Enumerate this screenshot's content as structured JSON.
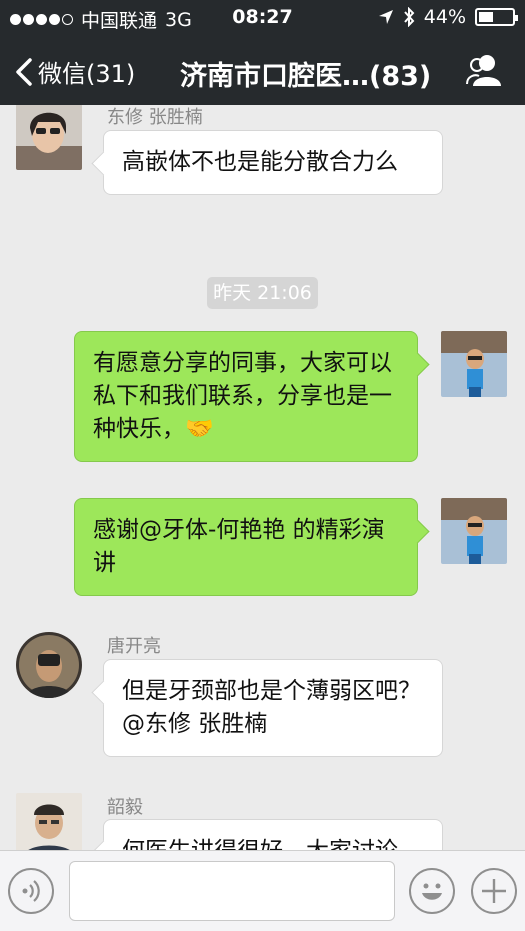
{
  "status_bar": {
    "carrier": "中国联通",
    "network": "3G",
    "time": "08:27",
    "battery": "44%",
    "signal_bars": 4
  },
  "nav": {
    "back_label": "微信(31)",
    "title": "济南市口腔医…(83)",
    "profile_icon": "group-profile-icon"
  },
  "messages": [
    {
      "side": "left",
      "sender": "东修 张胜楠",
      "text": "高嵌体不也是能分散合力么"
    },
    {
      "side": "right",
      "text": "有愿意分享的同事，大家可以私下和我们联系，分享也是一种快乐，🤝"
    },
    {
      "side": "right",
      "text": "感谢@牙体-何艳艳 的精彩演讲"
    },
    {
      "side": "left",
      "sender": "唐开亮",
      "text": "但是牙颈部也是个薄弱区吧？@东修 张胜楠"
    },
    {
      "side": "left",
      "sender": "韶毅",
      "text": "何医生讲得很好，大家讨论"
    }
  ],
  "timestamp": "昨天 21:06",
  "input_bar": {
    "voice_icon": "voice-icon",
    "emoji_icon": "emoji-icon",
    "plus_icon": "plus-icon",
    "placeholder": ""
  }
}
